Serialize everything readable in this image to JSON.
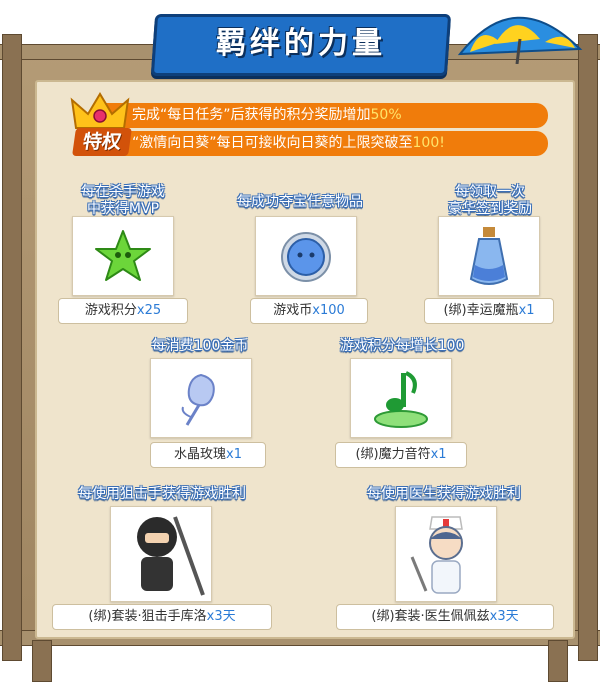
{
  "title": "羁绊的力量",
  "privilege": {
    "badge": "特权",
    "line1": {
      "prefix": "完成“每日任务”后获得的积分奖励增加",
      "highlight": "50%"
    },
    "line2": {
      "prefix": "“激情向日葵”每日可接收向日葵的上限突破至",
      "highlight": "100!"
    }
  },
  "rewards": [
    {
      "condition": [
        "每在杀手游戏",
        "中获得MVP"
      ],
      "item": "游戏积分",
      "qty": "x25",
      "icon": "green-star-icon"
    },
    {
      "condition": [
        "每成功夺宝任意物品"
      ],
      "item": "游戏币",
      "qty": "x100",
      "icon": "blue-coin-icon"
    },
    {
      "condition": [
        "每领取一次",
        "豪华签到奖励"
      ],
      "item": "(绑)幸运魔瓶",
      "qty": "x1",
      "icon": "magic-bottle-icon"
    },
    {
      "condition": [
        "每消费100金币"
      ],
      "item": "水晶玫瑰",
      "qty": "x1",
      "icon": "crystal-rose-icon"
    },
    {
      "condition": [
        "游戏积分每增长100"
      ],
      "item": "(绑)魔力音符",
      "qty": "x1",
      "icon": "magic-note-icon"
    },
    {
      "condition": [
        "每使用狙击手获得游戏胜利"
      ],
      "item": "(绑)套装·狙击手库洛",
      "qty": "x3天",
      "icon": "sniper-avatar-icon"
    },
    {
      "condition": [
        "每使用医生获得游戏胜利"
      ],
      "item": "(绑)套装·医生佩佩兹",
      "qty": "x3天",
      "icon": "nurse-avatar-icon"
    }
  ]
}
